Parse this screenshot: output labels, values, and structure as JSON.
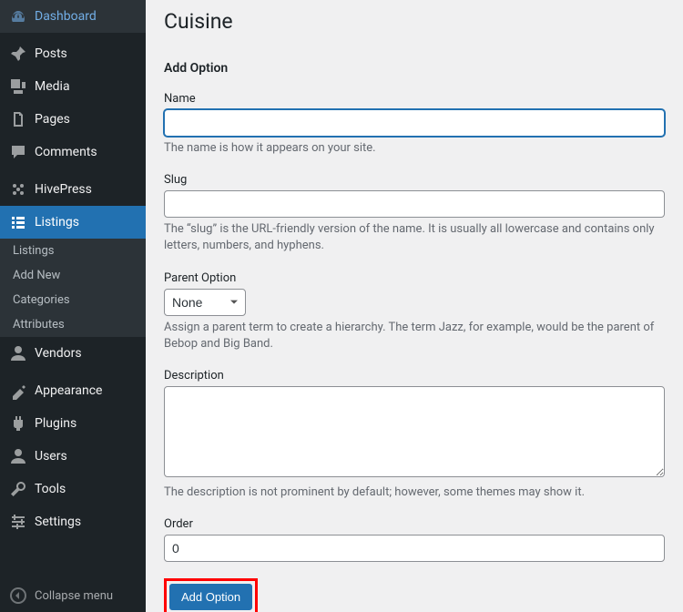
{
  "sidebar": {
    "items": [
      {
        "label": "Dashboard"
      },
      {
        "label": "Posts"
      },
      {
        "label": "Media"
      },
      {
        "label": "Pages"
      },
      {
        "label": "Comments"
      },
      {
        "label": "HivePress"
      },
      {
        "label": "Listings"
      },
      {
        "label": "Vendors"
      },
      {
        "label": "Appearance"
      },
      {
        "label": "Plugins"
      },
      {
        "label": "Users"
      },
      {
        "label": "Tools"
      },
      {
        "label": "Settings"
      }
    ],
    "submenu": [
      {
        "label": "Listings"
      },
      {
        "label": "Add New"
      },
      {
        "label": "Categories"
      },
      {
        "label": "Attributes"
      }
    ],
    "collapse": "Collapse menu"
  },
  "page": {
    "title": "Cuisine",
    "section": "Add Option"
  },
  "form": {
    "name": {
      "label": "Name",
      "value": "",
      "desc": "The name is how it appears on your site."
    },
    "slug": {
      "label": "Slug",
      "value": "",
      "desc": "The “slug” is the URL-friendly version of the name. It is usually all lowercase and contains only letters, numbers, and hyphens."
    },
    "parent": {
      "label": "Parent Option",
      "value": "None",
      "desc": "Assign a parent term to create a hierarchy. The term Jazz, for example, would be the parent of Bebop and Big Band."
    },
    "description": {
      "label": "Description",
      "value": "",
      "desc": "The description is not prominent by default; however, some themes may show it."
    },
    "order": {
      "label": "Order",
      "value": "0"
    },
    "submit": "Add Option"
  }
}
